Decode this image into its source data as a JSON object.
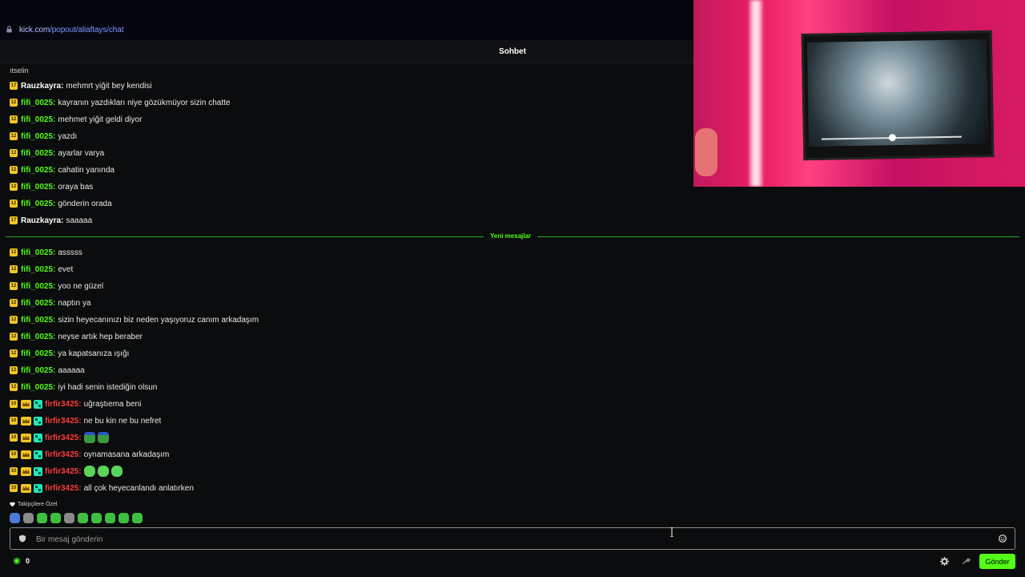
{
  "browser": {
    "url_host": "kick.com",
    "url_path": "/popout/aliaftays/chat"
  },
  "header": {
    "title": "Sohbet"
  },
  "pinned_partial": "ıtselin",
  "messages_before": [
    {
      "badge": "17",
      "user": "Rauzkayra",
      "color": "#ffffff",
      "text": "mehmrt yiğit bey kendisi"
    },
    {
      "badge": "12",
      "user": "fifi_0025",
      "color": "#53fc18",
      "text": "kayranın yazdıkları niye gözükmüyor sizin chatte"
    },
    {
      "badge": "12",
      "user": "fifi_0025",
      "color": "#53fc18",
      "text": "mehmet yiğit geldi diyor"
    },
    {
      "badge": "12",
      "user": "fifi_0025",
      "color": "#53fc18",
      "text": "yazdı"
    },
    {
      "badge": "12",
      "user": "fifi_0025",
      "color": "#53fc18",
      "text": "ayarlar varya"
    },
    {
      "badge": "12",
      "user": "fifi_0025",
      "color": "#53fc18",
      "text": "cahatin yanında"
    },
    {
      "badge": "12",
      "user": "fifi_0025",
      "color": "#53fc18",
      "text": "oraya bas"
    },
    {
      "badge": "12",
      "user": "fifi_0025",
      "color": "#53fc18",
      "text": "gönderin orada"
    },
    {
      "badge": "17",
      "user": "Rauzkayra",
      "color": "#ffffff",
      "text": "saaaaa"
    }
  ],
  "new_messages_label": "Yeni mesajlar",
  "messages_after": [
    {
      "badge": "12",
      "user": "fifi_0025",
      "color": "#53fc18",
      "text": "asssss"
    },
    {
      "badge": "12",
      "user": "fifi_0025",
      "color": "#53fc18",
      "text": "evet"
    },
    {
      "badge": "12",
      "user": "fifi_0025",
      "color": "#53fc18",
      "text": "yoo ne güzel"
    },
    {
      "badge": "12",
      "user": "fifi_0025",
      "color": "#53fc18",
      "text": "naptın ya"
    },
    {
      "badge": "12",
      "user": "fifi_0025",
      "color": "#53fc18",
      "text": "sizin heyecanınızı biz neden yaşıyoruz canım arkadaşım"
    },
    {
      "badge": "12",
      "user": "fifi_0025",
      "color": "#53fc18",
      "text": "neyse artık hep beraber"
    },
    {
      "badge": "12",
      "user": "fifi_0025",
      "color": "#53fc18",
      "text": "ya kapatsanıza ışığı"
    },
    {
      "badge": "12",
      "user": "fifi_0025",
      "color": "#53fc18",
      "text": "aaaaaa"
    },
    {
      "badge": "12",
      "user": "fifi_0025",
      "color": "#53fc18",
      "text": "iyi hadi senin istediğin olsun"
    },
    {
      "badge": "10",
      "user": "firfir3425",
      "color": "#ff3b3b",
      "extra_badges": true,
      "text": "uğraştıema beni"
    },
    {
      "badge": "10",
      "user": "firfir3425",
      "color": "#ff3b3b",
      "extra_badges": true,
      "text": "ne bu kin ne bu nefret"
    },
    {
      "badge": "10",
      "user": "firfir3425",
      "color": "#ff3b3b",
      "extra_badges": true,
      "text": "",
      "emotes": [
        "frog",
        "frog"
      ]
    },
    {
      "badge": "10",
      "user": "firfir3425",
      "color": "#ff3b3b",
      "extra_badges": true,
      "text": "oynamasana arkadaşım"
    },
    {
      "badge": "10",
      "user": "firfir3425",
      "color": "#ff3b3b",
      "extra_badges": true,
      "text": "",
      "emotes": [
        "green",
        "green",
        "green"
      ]
    },
    {
      "badge": "10",
      "user": "firfir3425",
      "color": "#ff3b3b",
      "extra_badges": true,
      "text": "all çok heyecanlandı anlatırken"
    }
  ],
  "followers_only_label": "Takipçilere Özel",
  "input": {
    "placeholder": "Bir mesaj gönderin"
  },
  "footer": {
    "points": "0",
    "send_label": "Gönder"
  },
  "colors": {
    "accent": "#53fc18",
    "background": "#0b0c0d"
  }
}
